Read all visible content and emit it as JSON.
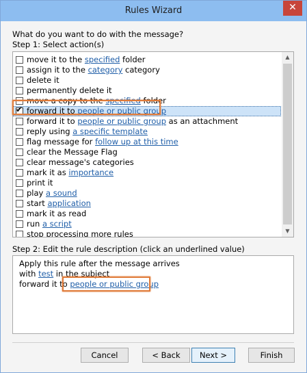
{
  "window": {
    "title": "Rules Wizard",
    "close_glyph": "✕"
  },
  "prompt": "What do you want to do with the message?",
  "step1_label": "Step 1: Select action(s)",
  "actions": [
    {
      "pre": "move it to the ",
      "link": "specified",
      "post": " folder",
      "checked": false
    },
    {
      "pre": "assign it to the ",
      "link": "category",
      "post": " category",
      "checked": false
    },
    {
      "pre": "delete it",
      "link": "",
      "post": "",
      "checked": false
    },
    {
      "pre": "permanently delete it",
      "link": "",
      "post": "",
      "checked": false
    },
    {
      "pre": "move a copy to the ",
      "link": "specified",
      "post": " folder",
      "checked": false
    },
    {
      "pre": "forward it to ",
      "link": "people or public group",
      "post": "",
      "checked": true
    },
    {
      "pre": "forward it to ",
      "link": "people or public group",
      "post": " as an attachment",
      "checked": false
    },
    {
      "pre": "reply using ",
      "link": "a specific template",
      "post": "",
      "checked": false
    },
    {
      "pre": "flag message for ",
      "link": "follow up at this time",
      "post": "",
      "checked": false
    },
    {
      "pre": "clear the Message Flag",
      "link": "",
      "post": "",
      "checked": false
    },
    {
      "pre": "clear message's categories",
      "link": "",
      "post": "",
      "checked": false
    },
    {
      "pre": "mark it as ",
      "link": "importance",
      "post": "",
      "checked": false
    },
    {
      "pre": "print it",
      "link": "",
      "post": "",
      "checked": false
    },
    {
      "pre": "play ",
      "link": "a sound",
      "post": "",
      "checked": false
    },
    {
      "pre": "start ",
      "link": "application",
      "post": "",
      "checked": false
    },
    {
      "pre": "mark it as read",
      "link": "",
      "post": "",
      "checked": false
    },
    {
      "pre": "run ",
      "link": "a script",
      "post": "",
      "checked": false
    },
    {
      "pre": "stop processing more rules",
      "link": "",
      "post": "",
      "checked": false
    }
  ],
  "step2_label": "Step 2: Edit the rule description (click an underlined value)",
  "description": {
    "line1": "Apply this rule after the message arrives",
    "line2_pre": "with ",
    "line2_link": "test",
    "line2_post": " in the subject",
    "line3_pre": "forward it to ",
    "line3_link": "people or public group"
  },
  "buttons": {
    "cancel": "Cancel",
    "back": "< Back",
    "next": "Next >",
    "finish": "Finish"
  },
  "colors": {
    "link": "#1f5ea8",
    "highlight": "#e07b39",
    "titlebar": "#8dbdf0",
    "close": "#c7453a",
    "selection": "#cde3f8"
  }
}
